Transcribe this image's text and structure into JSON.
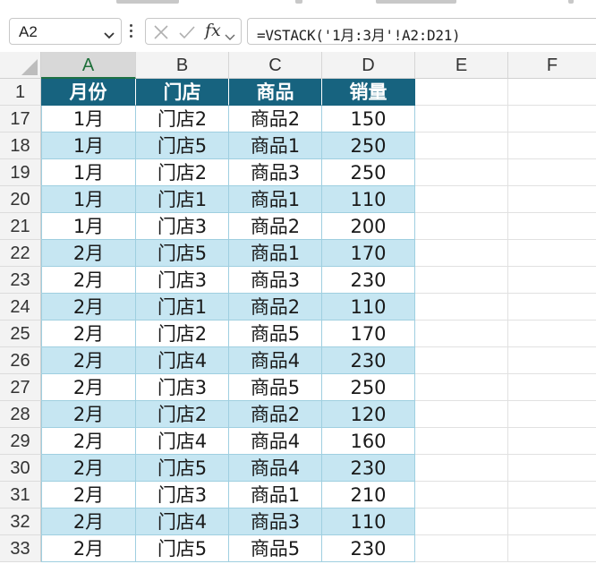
{
  "name_box": {
    "value": "A2"
  },
  "formula_bar": {
    "formula": "=VSTACK('1月:3月'!A2:D21)",
    "fx_label": "fx"
  },
  "icons": {
    "cancel": "close-icon",
    "enter": "check-icon",
    "insert_function": "fx-icon",
    "name_box_dropdown": "chevron-down-icon"
  },
  "colors": {
    "header_fill": "#17637f",
    "band_fill": "#c6e6f2",
    "selection_border": "#1e7145"
  },
  "column_headers": [
    "A",
    "B",
    "C",
    "D",
    "E",
    "F"
  ],
  "table_header": {
    "row_number": "1",
    "cells": [
      "月份",
      "门店",
      "商品",
      "销量"
    ]
  },
  "rows": [
    {
      "row_number": "17",
      "cells": [
        "1月",
        "门店2",
        "商品2",
        "150"
      ]
    },
    {
      "row_number": "18",
      "cells": [
        "1月",
        "门店5",
        "商品1",
        "250"
      ]
    },
    {
      "row_number": "19",
      "cells": [
        "1月",
        "门店2",
        "商品3",
        "250"
      ]
    },
    {
      "row_number": "20",
      "cells": [
        "1月",
        "门店1",
        "商品1",
        "110"
      ]
    },
    {
      "row_number": "21",
      "cells": [
        "1月",
        "门店3",
        "商品2",
        "200"
      ]
    },
    {
      "row_number": "22",
      "cells": [
        "2月",
        "门店5",
        "商品1",
        "170"
      ]
    },
    {
      "row_number": "23",
      "cells": [
        "2月",
        "门店3",
        "商品3",
        "230"
      ]
    },
    {
      "row_number": "24",
      "cells": [
        "2月",
        "门店1",
        "商品2",
        "110"
      ]
    },
    {
      "row_number": "25",
      "cells": [
        "2月",
        "门店2",
        "商品5",
        "170"
      ]
    },
    {
      "row_number": "26",
      "cells": [
        "2月",
        "门店4",
        "商品4",
        "230"
      ]
    },
    {
      "row_number": "27",
      "cells": [
        "2月",
        "门店3",
        "商品5",
        "250"
      ]
    },
    {
      "row_number": "28",
      "cells": [
        "2月",
        "门店2",
        "商品2",
        "120"
      ]
    },
    {
      "row_number": "29",
      "cells": [
        "2月",
        "门店4",
        "商品4",
        "160"
      ]
    },
    {
      "row_number": "30",
      "cells": [
        "2月",
        "门店5",
        "商品4",
        "230"
      ]
    },
    {
      "row_number": "31",
      "cells": [
        "2月",
        "门店3",
        "商品1",
        "210"
      ]
    },
    {
      "row_number": "32",
      "cells": [
        "2月",
        "门店4",
        "商品3",
        "110"
      ]
    },
    {
      "row_number": "33",
      "cells": [
        "2月",
        "门店5",
        "商品5",
        "230"
      ]
    }
  ]
}
